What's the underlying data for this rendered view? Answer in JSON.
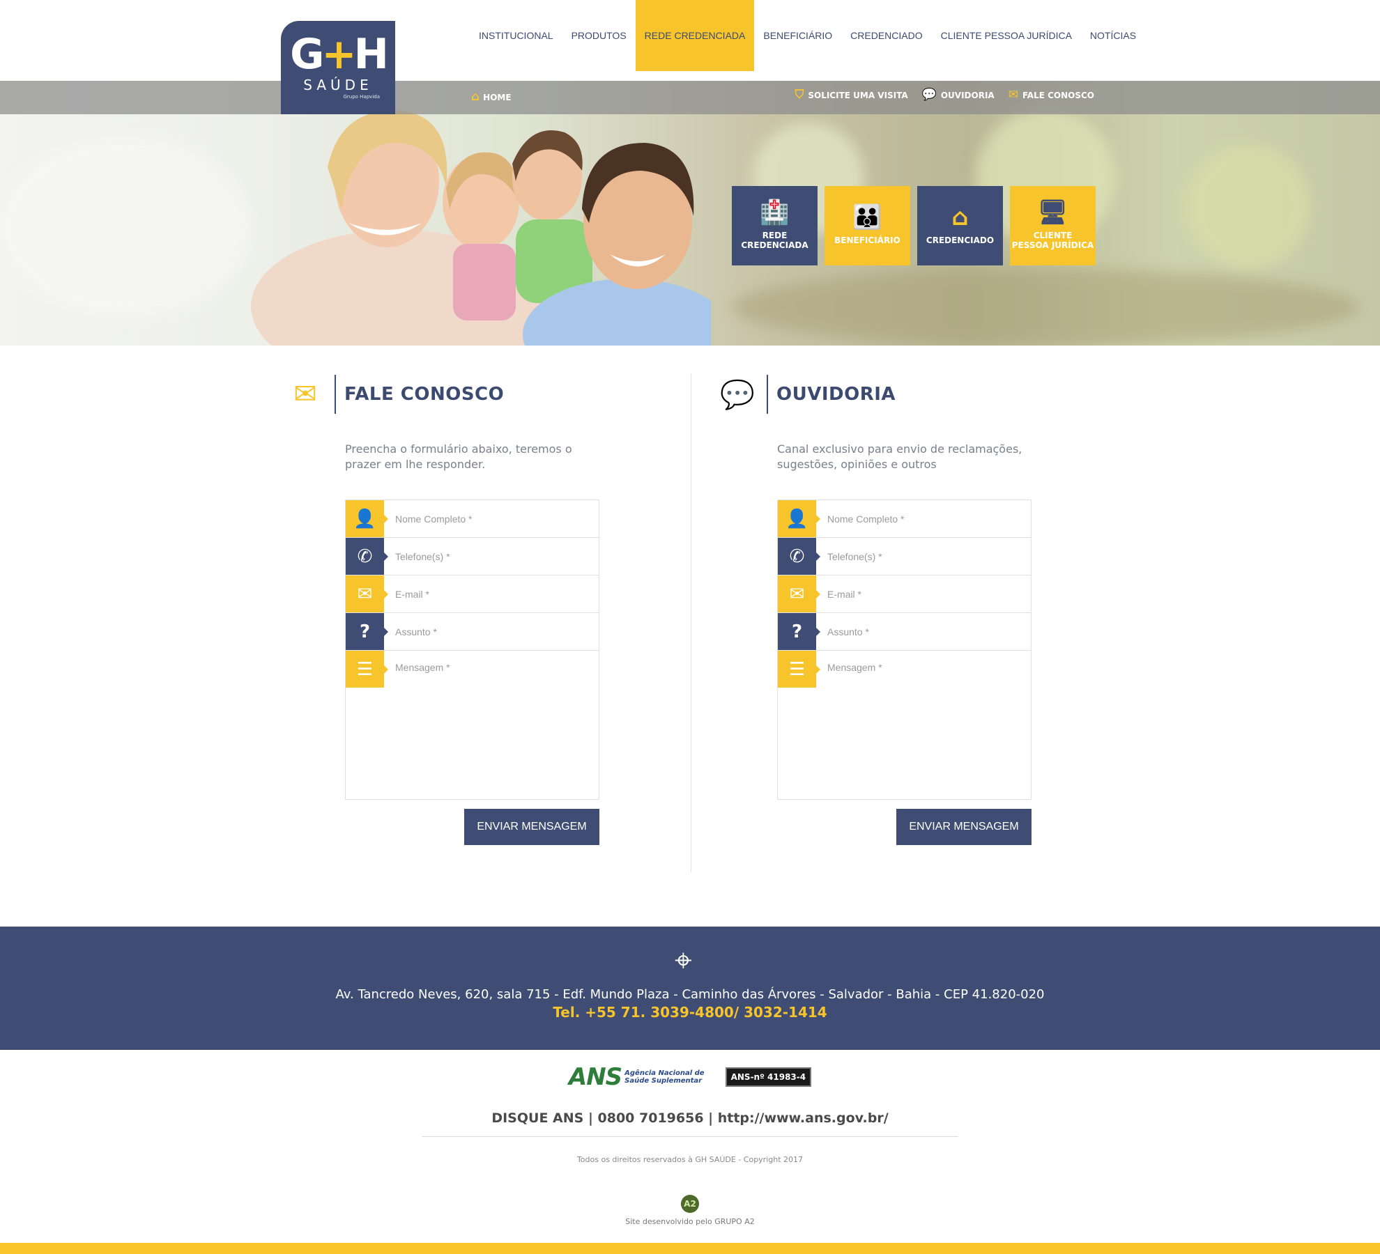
{
  "logo": {
    "mark": "GH",
    "plus": "+",
    "word": "SAÚDE",
    "group": "Grupo Hapvida"
  },
  "nav": [
    {
      "label": "INSTITUCIONAL"
    },
    {
      "label": "PRODUTOS"
    },
    {
      "label": "REDE CREDENCIADA",
      "active": true
    },
    {
      "label": "BENEFICIÁRIO"
    },
    {
      "label": "CREDENCIADO"
    },
    {
      "label": "CLIENTE PESSOA JURÍDICA"
    },
    {
      "label": "NOTÍCIAS"
    }
  ],
  "subbar": {
    "home": "HOME",
    "links": [
      {
        "label": "SOLICITE UMA VISITA",
        "icon": "visit-icon"
      },
      {
        "label": "OUVIDORIA",
        "icon": "chat-bubbles-icon"
      },
      {
        "label": "FALE CONOSCO",
        "icon": "envelope-icon"
      }
    ]
  },
  "tiles": [
    {
      "label_1": "REDE",
      "label_2": "CREDENCIADA",
      "icon": "hospital-icon",
      "color": "#3f4c74"
    },
    {
      "label_1": "BENEFICIÁRIO",
      "label_2": "",
      "icon": "people-icon",
      "color": "#f7c52b"
    },
    {
      "label_1": "CREDENCIADO",
      "label_2": "",
      "icon": "house-cross-icon",
      "color": "#3f4c74"
    },
    {
      "label_1": "CLIENTE",
      "label_2": "PESSOA JURÍDICA",
      "icon": "monitor-icon",
      "color": "#f7c52b"
    }
  ],
  "fale_conosco": {
    "title": "FALE CONOSCO",
    "desc": "Preencha o formulário abaixo, teremos o prazer em lhe responder.",
    "fields": {
      "name": "Nome Completo *",
      "phone": "Telefone(s) *",
      "email": "E-mail *",
      "subject": "Assunto *",
      "message": "Mensagem *"
    },
    "button": "ENVIAR MENSAGEM"
  },
  "ouvidoria": {
    "title": "OUVIDORIA",
    "desc": "Canal exclusivo para envio de reclamações, sugestões, opiniões e outros",
    "fields": {
      "name": "Nome Completo *",
      "phone": "Telefone(s) *",
      "email": "E-mail *",
      "subject": "Assunto *",
      "message": "Mensagem *"
    },
    "button": "ENVIAR MENSAGEM"
  },
  "footer": {
    "address": "Av. Tancredo Neves, 620, sala 715 - Edf. Mundo Plaza - Caminho das Árvores - Salvador - Bahia - CEP 41.820-020",
    "phone": "Tel. +55 71. 3039-4800/ 3032-1414"
  },
  "ans": {
    "logo_text": "ANS",
    "logo_line1": "Agência Nacional de",
    "logo_line2": "Saúde Suplementar",
    "badge": "ANS-nº 41983-4",
    "disque": "DISQUE ANS | 0800 7019656 | http://www.ans.gov.br/",
    "rights": "Todos os direitos reservados à GH SAÚDE - Copyright 2017",
    "dev_logo": "A2",
    "dev": "Site desenvolvido pelo GRUPO A2"
  },
  "colors": {
    "brand_blue": "#3f4c74",
    "brand_yellow": "#f7c52b"
  }
}
